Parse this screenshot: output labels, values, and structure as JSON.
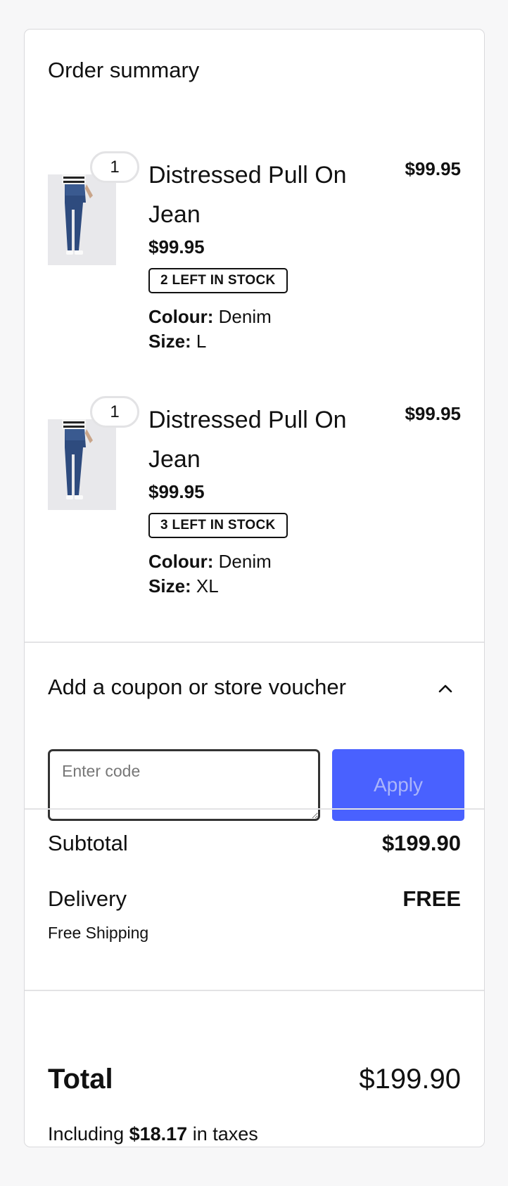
{
  "summary": {
    "title": "Order summary"
  },
  "items": [
    {
      "quantity": "1",
      "name": "Distressed Pull On Jean",
      "line_price": "$99.95",
      "unit_price": "$99.95",
      "stock": "2 LEFT IN STOCK",
      "colour_label": "Colour:",
      "colour": "Denim",
      "size_label": "Size:",
      "size": "L"
    },
    {
      "quantity": "1",
      "name": "Distressed Pull On Jean",
      "line_price": "$99.95",
      "unit_price": "$99.95",
      "stock": "3 LEFT IN STOCK",
      "colour_label": "Colour:",
      "colour": "Denim",
      "size_label": "Size:",
      "size": "XL"
    }
  ],
  "coupon": {
    "label": "Add a coupon or store voucher",
    "toggle_icon": "chevron-up-icon",
    "placeholder": "Enter code",
    "value": "",
    "apply_label": "Apply",
    "apply_color": "#4961ff"
  },
  "costs": {
    "subtotal_label": "Subtotal",
    "subtotal_value": "$199.90",
    "delivery_label": "Delivery",
    "delivery_value": "FREE",
    "delivery_note": "Free Shipping"
  },
  "total": {
    "label": "Total",
    "value": "$199.90",
    "tax_prefix": "Including",
    "tax_amount": "$18.17",
    "tax_suffix": "in taxes"
  }
}
